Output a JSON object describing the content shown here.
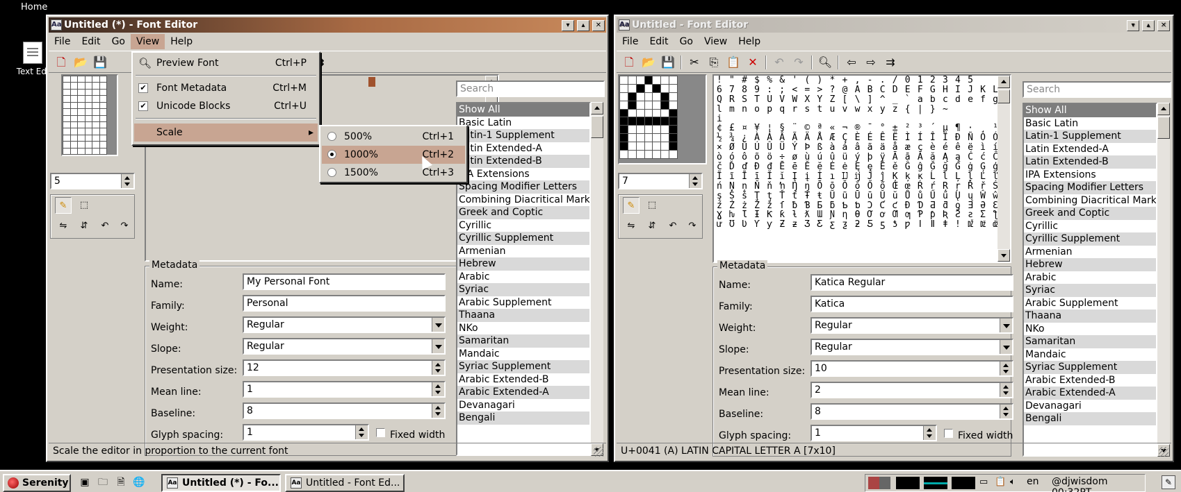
{
  "desktop": {
    "home_label": "Home",
    "icon_label": "Text Edi"
  },
  "window1": {
    "title": "Untitled (*) - Font Editor",
    "menus": [
      "File",
      "Edit",
      "Go",
      "View",
      "Help"
    ],
    "glyph_number": "5",
    "search_placeholder": "Search",
    "metadata": {
      "group_title": "Metadata",
      "name_label": "Name:",
      "name_value": "My Personal Font",
      "family_label": "Family:",
      "family_value": "Personal",
      "weight_label": "Weight:",
      "weight_value": "Regular",
      "slope_label": "Slope:",
      "slope_value": "Regular",
      "presentation_label": "Presentation size:",
      "presentation_value": "12",
      "meanline_label": "Mean line:",
      "meanline_value": "1",
      "baseline_label": "Baseline:",
      "baseline_value": "8",
      "spacing_label": "Glyph spacing:",
      "spacing_value": "1",
      "fixed_width_label": "Fixed width"
    },
    "blocks": [
      "Show All",
      "Basic Latin",
      "Latin-1 Supplement",
      "Latin Extended-A",
      "Latin Extended-B",
      "IPA Extensions",
      "Spacing Modifier Letters",
      "Combining Diacritical Marks",
      "Greek and Coptic",
      "Cyrillic",
      "Cyrillic Supplement",
      "Armenian",
      "Hebrew",
      "Arabic",
      "Syriac",
      "Arabic Supplement",
      "Thaana",
      "NKo",
      "Samaritan",
      "Mandaic",
      "Syriac Supplement",
      "Arabic Extended-B",
      "Arabic Extended-A",
      "Devanagari",
      "Bengali"
    ],
    "status": "Scale the editor in proportion to the current font"
  },
  "view_menu": {
    "items": [
      {
        "label": "Preview Font",
        "shortcut": "Ctrl+P",
        "icon": "magnifier-icon"
      },
      {
        "label": "Font Metadata",
        "shortcut": "Ctrl+M",
        "checked": true
      },
      {
        "label": "Unicode Blocks",
        "shortcut": "Ctrl+U",
        "checked": true
      },
      {
        "label": "Scale"
      }
    ]
  },
  "scale_menu": {
    "items": [
      {
        "label": "500%",
        "shortcut": "Ctrl+1",
        "selected": false
      },
      {
        "label": "1000%",
        "shortcut": "Ctrl+2",
        "selected": true
      },
      {
        "label": "1500%",
        "shortcut": "Ctrl+3",
        "selected": false
      }
    ]
  },
  "window2": {
    "title": "Untitled - Font Editor",
    "menus": [
      "File",
      "Edit",
      "Go",
      "View",
      "Help"
    ],
    "glyph_number": "7",
    "search_placeholder": "Search",
    "glyph_map_lines": [
      "  ! \" # $ % & ' ( ) * + , - . / 0 1 2 3 4 5",
      "6 7 8 9 : ; < = > ? @ A B C D E F G H I J K L M N O P",
      "Q R S T U V W X Y Z [ \\ ] ^ _ ` a b c d e f g h i j k",
      "l m n o p q r s t u v w x y z { | } ~",
      "                                            i",
      "¢ £ ¤ ¥ ¦ § ¨ © ª « ¬   ® ¯ ° ± ² ³ ´ µ ¶ · ¸ ¹ º » ¼",
      "½ ¾ ¿ À Á Â Ã Ä Å Æ Ç È É Ê Ë Ì Í Î Ï Ð Ñ Ò Ó Ô Õ Ö",
      "× Ø Ù Ú Û Ü Ý Þ ß à á â ã ä å æ ç è é ê ë ì í î ï ð ñ",
      "ò ó ô õ ö ÷ ø ù ú û ü ý þ ÿ Ā ā Ă ă Ą ą Ć ć Ĉ ĉ Ċ ċ Č",
      "č Ď ď Đ đ Ē ē Ĕ ĕ Ė ė Ę ę Ě ě Ĝ ĝ Ğ ğ Ġ ġ Ģ ģ Ĥ ĥ Ħ ħ",
      "Ĩ ĩ Ī ī Ĭ ĭ Į į İ ı Ĳ ĳ Ĵ ĵ Ķ ķ ĸ Ĺ ĺ Ļ ļ Ľ ľ Ŀ ŀ Ł ł Ń",
      "ń Ņ ņ Ň ň ŉ Ŋ ŋ Ō ō Ŏ ŏ Ő ő Œ œ Ŕ ŕ Ŗ ŗ Ř ř Ś ś Ŝ ŝ Ş",
      "ş Š š Ţ ţ Ť ť Ŧ ŧ Ũ ũ Ū ū Ŭ ŭ Ů ů Ű ű Ų ų Ŵ ŵ Ŷ ŷ Ÿ Ź",
      "ź Ż ż Ž ž ſ ƀ Ɓ Ƃ ƃ Ƅ ƅ Ɔ Ƈ ƈ Ɖ Ɗ Ƌ ƌ ƍ Ǝ Ə Ɛ Ƒ ƒ Ɠ",
      "Ɣ ƕ Ɩ Ɨ Ƙ ƙ ƚ ƛ Ɯ Ɲ ƞ Ɵ Ơ ơ Ƣ ƣ Ƥ ƥ Ʀ Ƨ ƨ Ʃ ƪ ƫ Ƭ ƭ Ʈ Ư",
      "ư Ʊ Ʋ Ƴ ƴ Ƶ ƶ Ʒ Ƹ ƹ ƺ ƻ Ƽ ƽ ƾ ƿ ǀ ǁ ǂ ǃ Ǆ ǅ ǆ Ǉ ǈ ǉ Ǌ"
    ],
    "metadata": {
      "group_title": "Metadata",
      "name_label": "Name:",
      "name_value": "Katica Regular",
      "family_label": "Family:",
      "family_value": "Katica",
      "weight_label": "Weight:",
      "weight_value": "Regular",
      "slope_label": "Slope:",
      "slope_value": "Regular",
      "presentation_label": "Presentation size:",
      "presentation_value": "10",
      "meanline_label": "Mean line:",
      "meanline_value": "2",
      "baseline_label": "Baseline:",
      "baseline_value": "8",
      "spacing_label": "Glyph spacing:",
      "spacing_value": "1",
      "fixed_width_label": "Fixed width"
    },
    "blocks": [
      "Show All",
      "Basic Latin",
      "Latin-1 Supplement",
      "Latin Extended-A",
      "Latin Extended-B",
      "IPA Extensions",
      "Spacing Modifier Letters",
      "Combining Diacritical Marks",
      "Greek and Coptic",
      "Cyrillic",
      "Cyrillic Supplement",
      "Armenian",
      "Hebrew",
      "Arabic",
      "Syriac",
      "Arabic Supplement",
      "Thaana",
      "NKo",
      "Samaritan",
      "Mandaic",
      "Syriac Supplement",
      "Arabic Extended-B",
      "Arabic Extended-A",
      "Devanagari",
      "Bengali"
    ],
    "status": "U+0041 (A) LATIN CAPITAL LETTER A [7x10]"
  },
  "taskbar": {
    "start_label": "Serenity",
    "task1": "Untitled (*) - Fo...",
    "task2": "Untitled - Font Ed...",
    "lang": "en",
    "clock": "@djwisdom 00:32PT"
  }
}
